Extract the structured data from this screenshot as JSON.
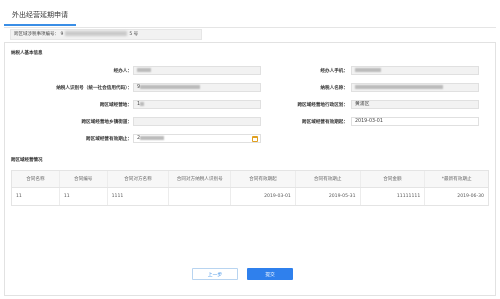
{
  "tab": {
    "label": "外出经营延期申请"
  },
  "matter": {
    "label": "跨区域涉税事项编号",
    "prefix": "9",
    "suffix": "5 号"
  },
  "basic": {
    "section_title": "纳税人基本信息",
    "handler_label": "经办人：",
    "handler_value": "",
    "handler_phone_label": "经办人手机：",
    "handler_phone_value": "",
    "taxpayer_id_label": "纳税人识别号（统一社会信用代码）：",
    "taxpayer_id_value": "9",
    "taxpayer_name_label": "纳税人名称：",
    "taxpayer_name_value": "",
    "business_place_label": "跨区域经营地：",
    "business_place_value": "1",
    "business_district_label": "跨区域经营地行政区划：",
    "business_district_value": "黄浦区",
    "business_street_label": "跨区域经营地乡镇街道：",
    "business_street_value": "",
    "valid_from_label": "跨区域经营有效期起：",
    "valid_from_value": "2019-03-01",
    "valid_to_label": "跨区域经营有效期止：",
    "valid_to_value": "2"
  },
  "contracts": {
    "section_title": "跨区域经营情况",
    "columns": [
      "合同名称",
      "合同编号",
      "合同对方名称",
      "合同对方纳税人识别号",
      "合同有效期起",
      "合同有效期止",
      "合同金额",
      "*最新有效期止"
    ],
    "rows": [
      [
        "11",
        "11",
        "1111",
        "",
        "2019-03-01",
        "2019-05-31",
        "11111111",
        "2019-06-30"
      ]
    ]
  },
  "buttons": {
    "prev": "上一步",
    "submit": "提交"
  },
  "colors": {
    "accent": "#2f80ed",
    "calendar": "#e0a020"
  },
  "icons": [
    "calendar-icon"
  ]
}
